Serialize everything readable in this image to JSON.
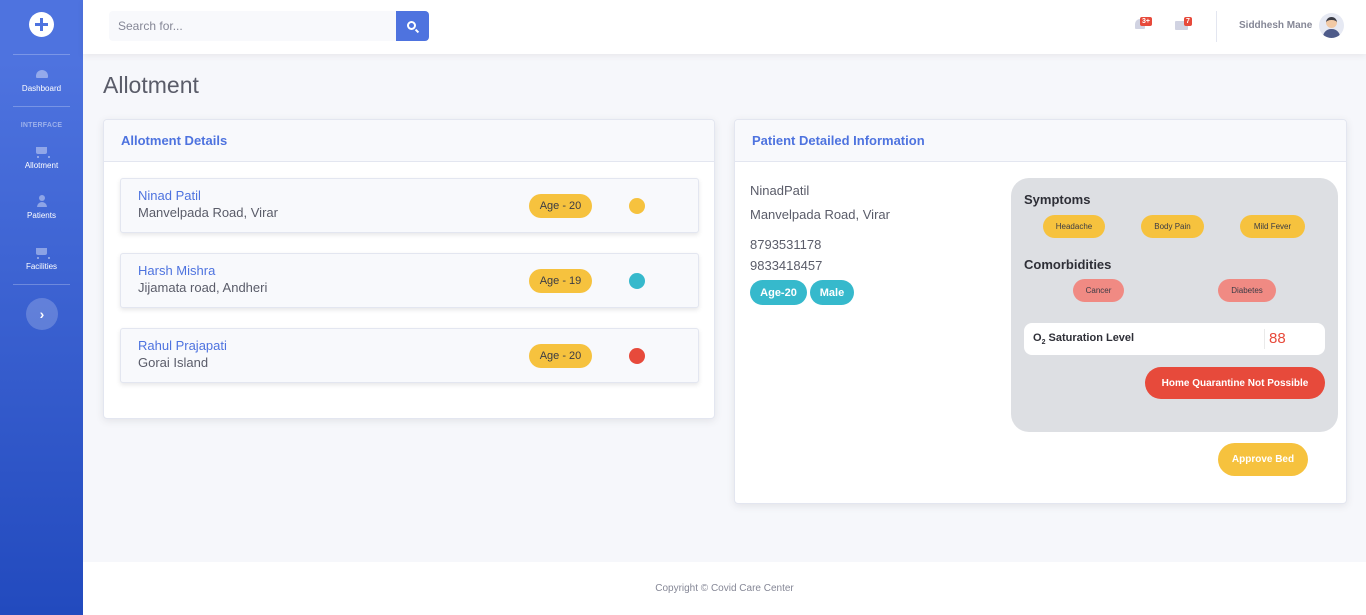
{
  "sidebar": {
    "items": [
      {
        "label": "Dashboard",
        "icon": "dashboard-icon"
      },
      {
        "label": "Allotment",
        "icon": "cart-icon"
      },
      {
        "label": "Patients",
        "icon": "user-icon"
      },
      {
        "label": "Facilities",
        "icon": "cart-icon"
      }
    ],
    "heading": "INTERFACE",
    "toggle_glyph": "›"
  },
  "topbar": {
    "search_placeholder": "Search for...",
    "alerts_count": "3+",
    "messages_count": "7",
    "user_name": "Siddhesh Mane"
  },
  "page": {
    "title": "Allotment"
  },
  "allotment": {
    "header": "Allotment Details",
    "rows": [
      {
        "name": "Ninad Patil",
        "address": "Manvelpada Road, Virar",
        "age": "Age - 20",
        "status_color": "#f6c23e"
      },
      {
        "name": "Harsh Mishra",
        "address": "Jijamata road, Andheri",
        "age": "Age - 19",
        "status_color": "#36b9cc"
      },
      {
        "name": "Rahul Prajapati",
        "address": "Gorai Island",
        "age": "Age - 20",
        "status_color": "#e74a3b"
      }
    ]
  },
  "patient": {
    "header": "Patient Detailed Information",
    "name": "NinadPatil",
    "address": "Manvelpada Road, Virar",
    "phone1": "8793531178",
    "phone2": "9833418457",
    "age_chip": "Age-20",
    "gender_chip": "Male",
    "symptoms_title": "Symptoms",
    "symptoms": [
      "Headache",
      "Body Pain",
      "Mild Fever"
    ],
    "comorbidities_title": "Comorbidities",
    "comorbidities": [
      "Cancer",
      "Diabetes"
    ],
    "o2_label_prefix": "O",
    "o2_label_sub": "2",
    "o2_label_suffix": " Saturation Level",
    "o2_value": "88",
    "quarantine_button": "Home Quarantine Not Possible",
    "approve_button": "Approve Bed"
  },
  "footer": {
    "text": "Copyright © Covid Care Center"
  },
  "colors": {
    "primary": "#4e73df",
    "warning": "#f6c23e",
    "info": "#36b9cc",
    "danger": "#e74a3b"
  }
}
